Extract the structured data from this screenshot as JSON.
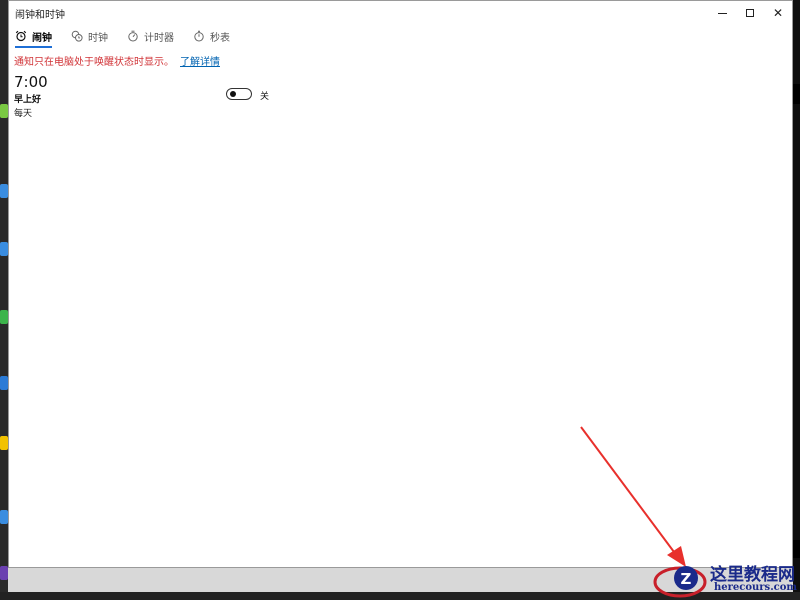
{
  "window": {
    "title": "闹钟和时钟"
  },
  "tabs": [
    {
      "label": "闹钟",
      "icon": "alarm-clock-icon",
      "active": true
    },
    {
      "label": "时钟",
      "icon": "world-clock-icon",
      "active": false
    },
    {
      "label": "计时器",
      "icon": "timer-icon",
      "active": false
    },
    {
      "label": "秒表",
      "icon": "stopwatch-icon",
      "active": false
    }
  ],
  "notice": {
    "text": "通知只在电脑处于唤醒状态时显示。",
    "link": "了解详情"
  },
  "alarm": {
    "time": "7:00",
    "name": "早上好",
    "repeat": "每天",
    "toggle_label": "关",
    "enabled": false
  },
  "watermark": {
    "name": "这里教程网",
    "domain": "herecours.com"
  },
  "colors": {
    "accent": "#1e6fd6",
    "notice": "#d13438",
    "link": "#0063b1",
    "arrow": "#e8302c"
  }
}
